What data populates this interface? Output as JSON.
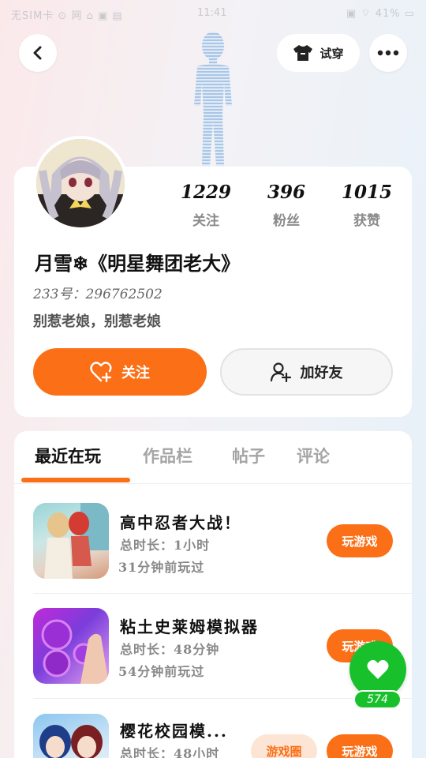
{
  "status_bar": {
    "left_text": "无SIM卡 ⊙ 网 ⌂ ▣ ▤",
    "time": "11:41",
    "right_text": "▣ ⌔ 41% ▭"
  },
  "header": {
    "tryon_label": "试穿"
  },
  "profile": {
    "stats": [
      {
        "value": "1229",
        "label": "关注"
      },
      {
        "value": "396",
        "label": "粉丝"
      },
      {
        "value": "1015",
        "label": "获赞"
      }
    ],
    "nickname": "月雪❄《明星舞团老大》",
    "uid": "233号：296762502",
    "bio": "别惹老娘，别惹老娘",
    "follow_label": "关注",
    "add_friend_label": "加好友"
  },
  "tabs": [
    "最近在玩",
    "作品栏",
    "帖子",
    "评论"
  ],
  "games": [
    {
      "title": "高中忍者大战！",
      "duration": "总时长：1小时",
      "last_played": "31分钟前玩过",
      "play_label": "玩游戏"
    },
    {
      "title": "粘土史莱姆模拟器",
      "duration": "总时长：48分钟",
      "last_played": "54分钟前玩过",
      "play_label": "玩游戏"
    },
    {
      "title": "樱花校园模...",
      "duration": "总时长：48小时",
      "circle_label": "游戏圈",
      "play_label": "玩游戏"
    }
  ],
  "like_fab": {
    "count": "574"
  },
  "colors": {
    "accent": "#fb6f17",
    "like_green": "#18c12b"
  }
}
